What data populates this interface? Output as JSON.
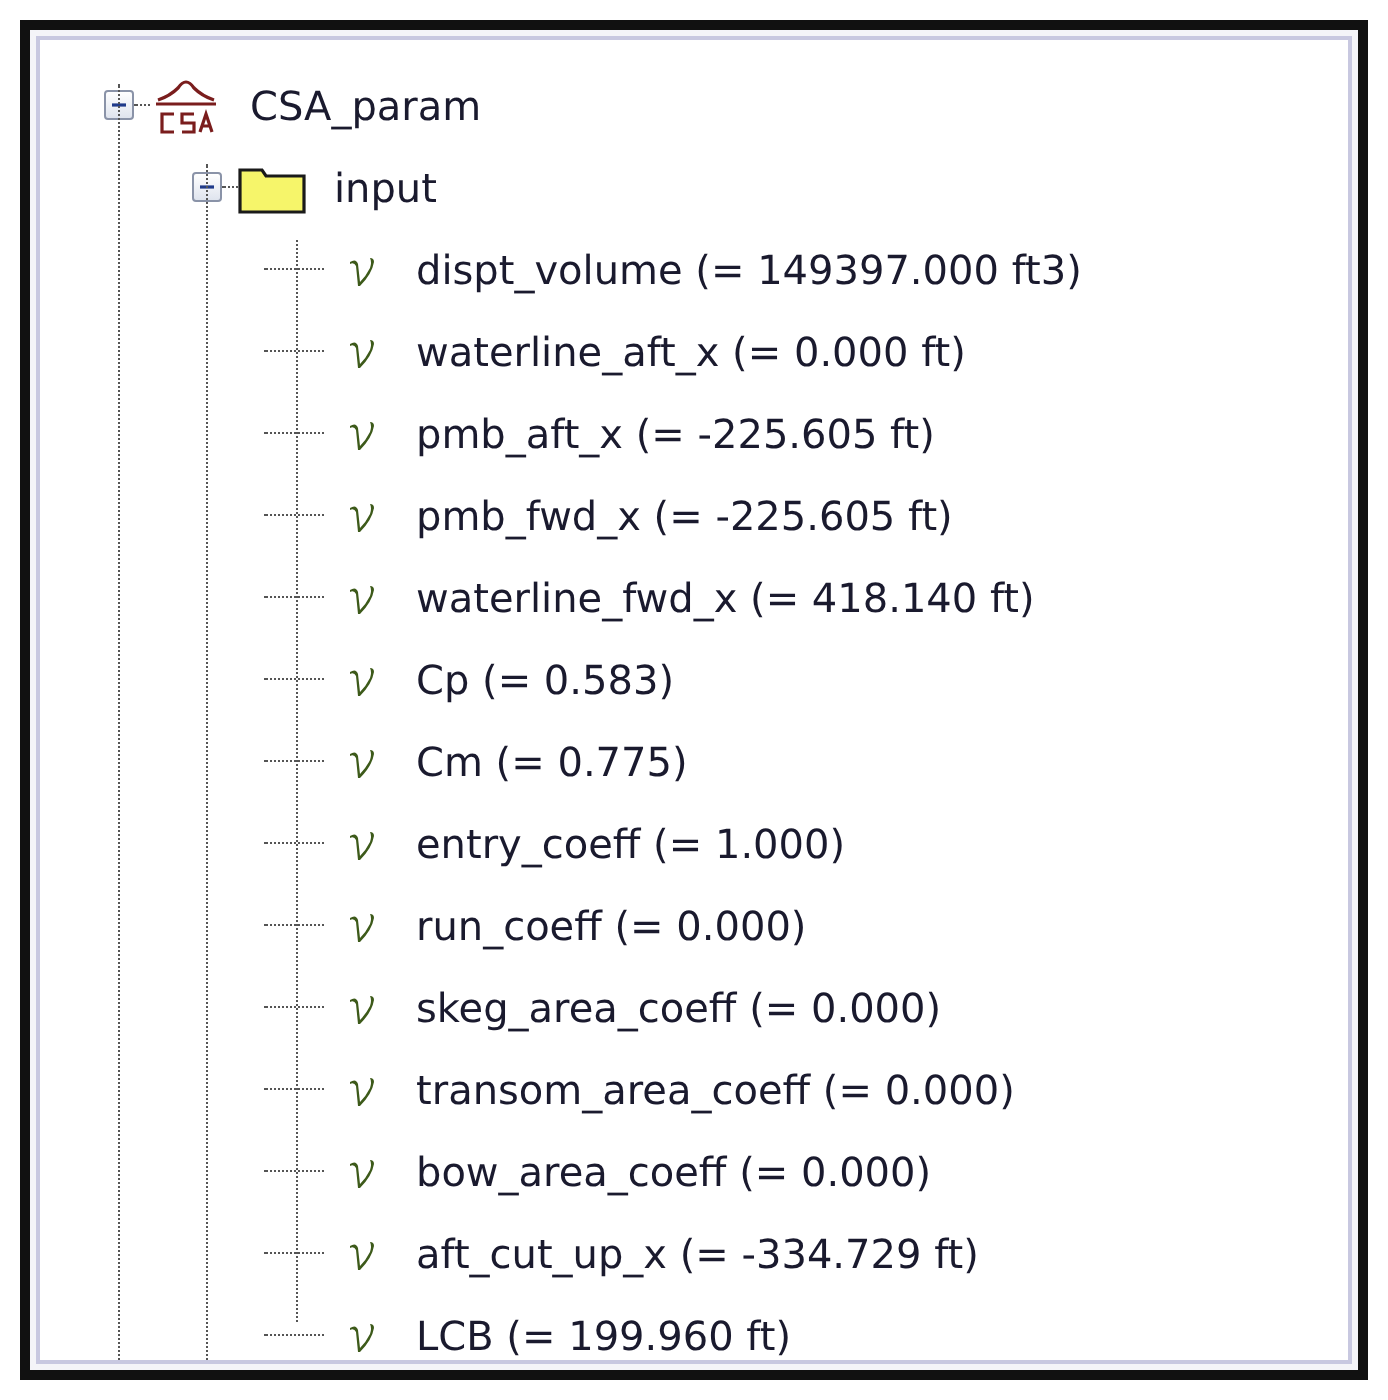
{
  "tree": [
    {
      "label": "CSA_param",
      "kind": "model",
      "expanded": true,
      "children": [
        {
          "label": "input",
          "kind": "folder",
          "expanded": true,
          "children": [
            {
              "label": "dispt_volume (= 149397.000 ft3)",
              "kind": "variable"
            },
            {
              "label": "waterline_aft_x (= 0.000 ft)",
              "kind": "variable"
            },
            {
              "label": "pmb_aft_x (= -225.605 ft)",
              "kind": "variable"
            },
            {
              "label": "pmb_fwd_x (= -225.605 ft)",
              "kind": "variable"
            },
            {
              "label": "waterline_fwd_x (= 418.140 ft)",
              "kind": "variable"
            },
            {
              "label": "Cp (= 0.583)",
              "kind": "variable"
            },
            {
              "label": "Cm (= 0.775)",
              "kind": "variable"
            },
            {
              "label": "entry_coeff (= 1.000)",
              "kind": "variable"
            },
            {
              "label": "run_coeff (= 0.000)",
              "kind": "variable"
            },
            {
              "label": "skeg_area_coeff (= 0.000)",
              "kind": "variable"
            },
            {
              "label": "transom_area_coeff (= 0.000)",
              "kind": "variable"
            },
            {
              "label": "bow_area_coeff (= 0.000)",
              "kind": "variable"
            },
            {
              "label": "aft_cut_up_x (= -334.729 ft)",
              "kind": "variable"
            },
            {
              "label": "LCB (= 199.960 ft)",
              "kind": "variable"
            }
          ]
        }
      ]
    }
  ]
}
